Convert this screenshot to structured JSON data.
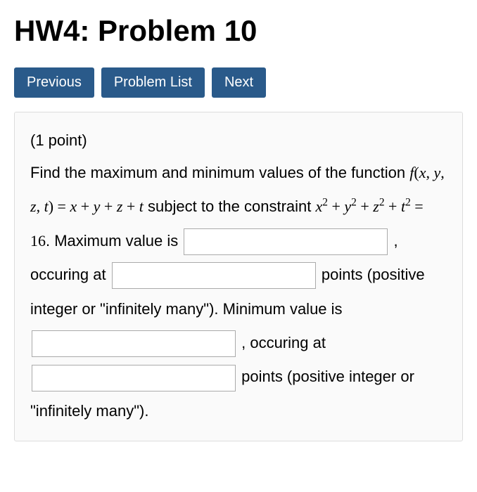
{
  "header": {
    "title": "HW4: Problem 10"
  },
  "nav": {
    "previous": "Previous",
    "problem_list": "Problem List",
    "next": "Next"
  },
  "problem": {
    "points_label": "(1 point)",
    "text1": "Find the maximum and minimum values of the function ",
    "func_expr": "f(x, y, z, t) = x + y + z + t",
    "text2": " subject to the constraint ",
    "constraint_expr": "x² + y² + z² + t² = 16",
    "text3": ". Maximum value is ",
    "text4": " , occuring at ",
    "text5": " points (positive integer or \"infinitely many\"). Minimum value is ",
    "text6": " , occuring at ",
    "text7": " points (positive integer or \"infinitely many\").",
    "inputs": {
      "max_value": "",
      "max_points": "",
      "min_value": "",
      "min_points": ""
    }
  }
}
